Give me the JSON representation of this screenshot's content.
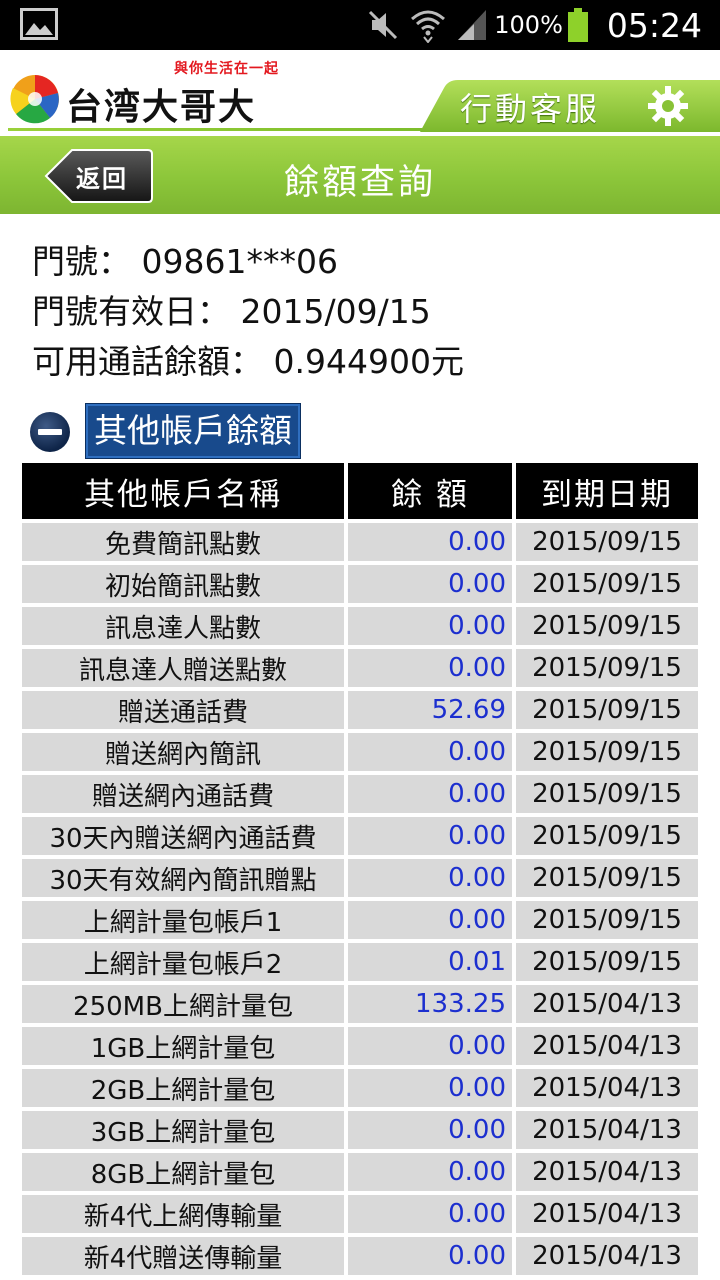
{
  "status_bar": {
    "battery_percent": "100%",
    "time": "05:24"
  },
  "header": {
    "slogan": "與你生活在一起",
    "brand": "台湾大哥大",
    "service_label": "行動客服"
  },
  "title_bar": {
    "back_label": "返回",
    "title": "餘額查詢"
  },
  "info": {
    "number_line": "門號： 09861***06",
    "expiry_line": "門號有效日： 2015/09/15",
    "balance_line": "可用通話餘額： 0.944900元"
  },
  "section": {
    "label": "其他帳戶餘額"
  },
  "table": {
    "headers": [
      "其他帳戶名稱",
      "餘 額",
      "到期日期"
    ],
    "rows": [
      {
        "name": "免費簡訊點數",
        "amount": "0.00",
        "date": "2015/09/15"
      },
      {
        "name": "初始簡訊點數",
        "amount": "0.00",
        "date": "2015/09/15"
      },
      {
        "name": "訊息達人點數",
        "amount": "0.00",
        "date": "2015/09/15"
      },
      {
        "name": "訊息達人贈送點數",
        "amount": "0.00",
        "date": "2015/09/15"
      },
      {
        "name": "贈送通話費",
        "amount": "52.69",
        "date": "2015/09/15"
      },
      {
        "name": "贈送網內簡訊",
        "amount": "0.00",
        "date": "2015/09/15"
      },
      {
        "name": "贈送網內通話費",
        "amount": "0.00",
        "date": "2015/09/15"
      },
      {
        "name": "30天內贈送網內通話費",
        "amount": "0.00",
        "date": "2015/09/15"
      },
      {
        "name": "30天有效網內簡訊贈點",
        "amount": "0.00",
        "date": "2015/09/15"
      },
      {
        "name": "上網計量包帳戶1",
        "amount": "0.00",
        "date": "2015/09/15"
      },
      {
        "name": "上網計量包帳戶2",
        "amount": "0.01",
        "date": "2015/09/15"
      },
      {
        "name": "250MB上網計量包",
        "amount": "133.25",
        "date": "2015/04/13"
      },
      {
        "name": "1GB上網計量包",
        "amount": "0.00",
        "date": "2015/04/13"
      },
      {
        "name": "2GB上網計量包",
        "amount": "0.00",
        "date": "2015/04/13"
      },
      {
        "name": "3GB上網計量包",
        "amount": "0.00",
        "date": "2015/04/13"
      },
      {
        "name": "8GB上網計量包",
        "amount": "0.00",
        "date": "2015/04/13"
      },
      {
        "name": "新4代上網傳輸量",
        "amount": "0.00",
        "date": "2015/04/13"
      },
      {
        "name": "新4代贈送傳輸量",
        "amount": "0.00",
        "date": "2015/04/13"
      }
    ]
  },
  "colors": {
    "accent_green": "#8cc63a",
    "amount_blue": "#1c2fcf",
    "section_blue": "#184a8c"
  }
}
